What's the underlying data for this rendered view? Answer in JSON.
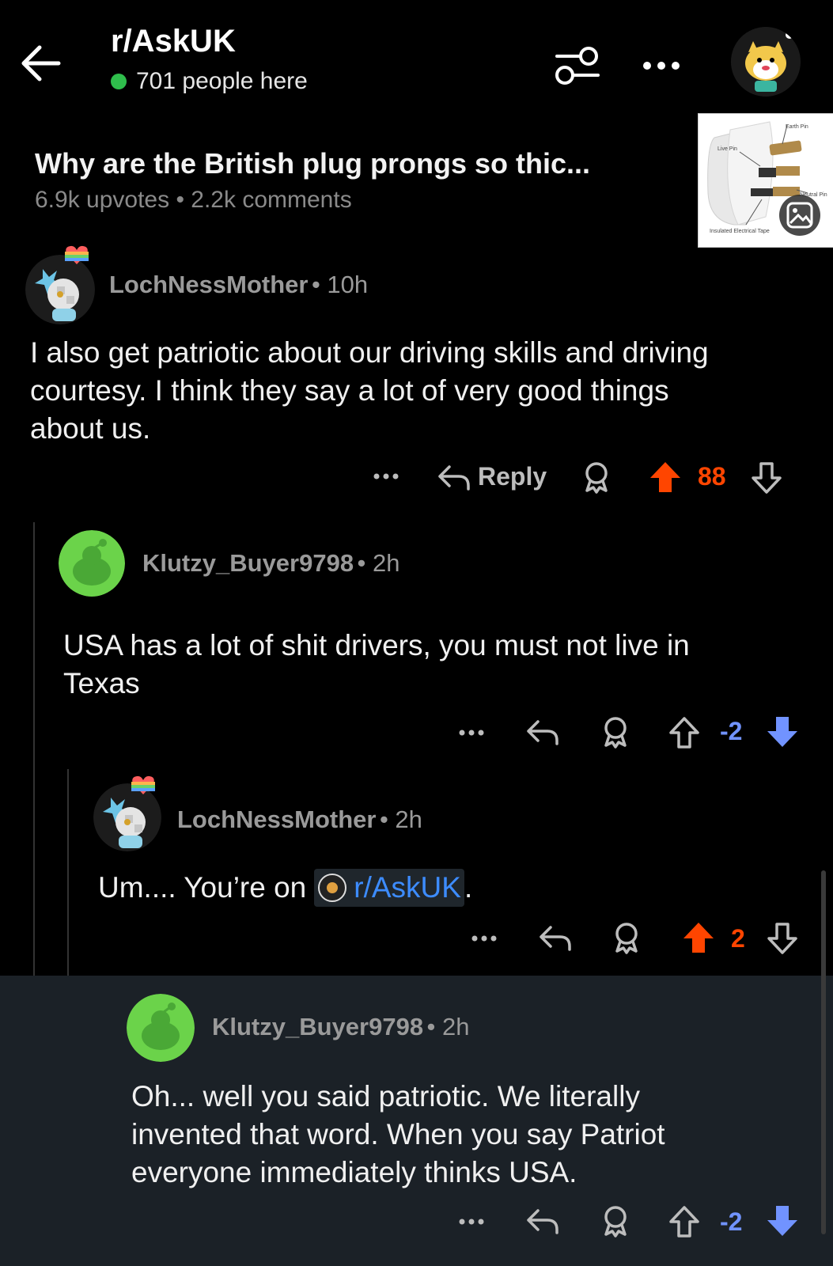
{
  "header": {
    "subreddit": "r/AskUK",
    "online": "701 people here"
  },
  "post": {
    "title": "Why are the British plug prongs so thic...",
    "meta": "6.9k upvotes • 2.2k comments",
    "thumbnail_labels": [
      "Earth Pin",
      "Live Pin",
      "Neutral Pin",
      "Insulated Electrical Tape"
    ]
  },
  "comments": [
    {
      "user": "LochNessMother",
      "time": "• 10h",
      "body_lines": [
        "I also get patriotic about our driving skills and driving",
        "courtesy.  I think they say a lot of very good things",
        "about us."
      ],
      "reply_label": "Reply",
      "score": "88",
      "vote": "up"
    },
    {
      "user": "Klutzy_Buyer9798",
      "time": "• 2h",
      "body_lines": [
        "USA has a lot of shit drivers, you must not live in",
        "Texas"
      ],
      "score": "-2",
      "vote": "down"
    },
    {
      "user": "LochNessMother",
      "time": "• 2h",
      "body_prefix": "Um.... You’re on",
      "body_link": "r/AskUK",
      "body_suffix": ".",
      "score": "2",
      "vote": "up"
    },
    {
      "user": "Klutzy_Buyer9798",
      "time": "• 2h",
      "body_lines": [
        "Oh... well you said patriotic. We literally",
        "invented that word. When you say Patriot",
        "everyone immediately thinks USA."
      ],
      "score": "-2",
      "vote": "down"
    }
  ],
  "colors": {
    "upvote": "#ff4500",
    "downvote": "#7193ff",
    "online": "#2fbe4c",
    "link": "#3d8cff"
  },
  "icons": [
    "back-arrow-icon",
    "filter-icon",
    "more-icon",
    "reply-icon",
    "award-icon",
    "upvote-icon",
    "downvote-icon",
    "image-icon"
  ]
}
